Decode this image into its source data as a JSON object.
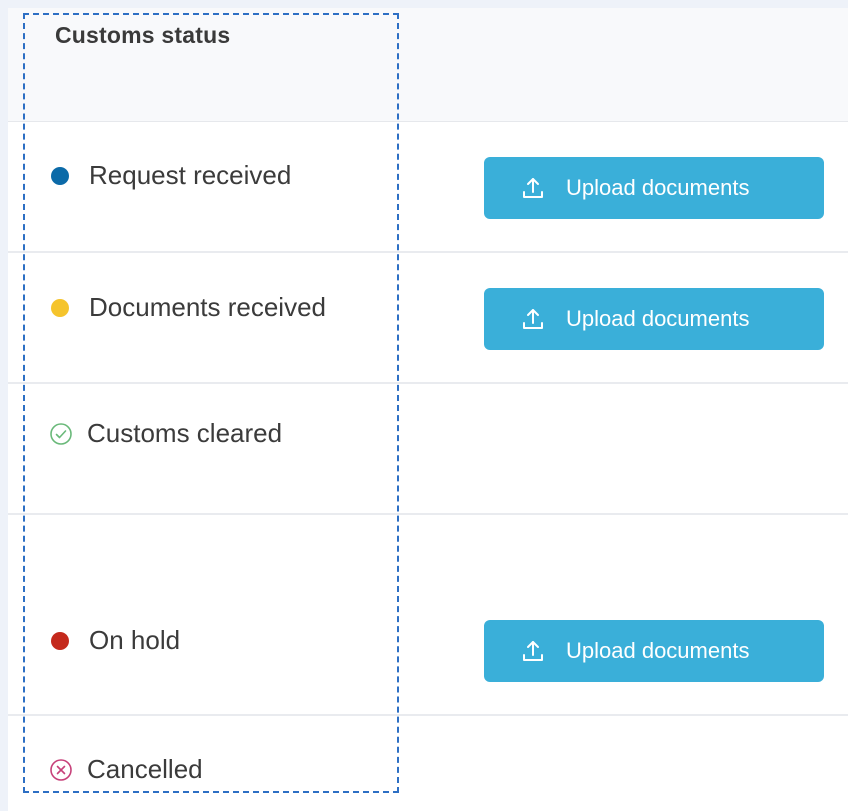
{
  "table": {
    "header": {
      "customs_status": "Customs status"
    },
    "rows": [
      {
        "status": "Request received",
        "indicator": "dot",
        "action": "Upload documents"
      },
      {
        "status": "Documents received",
        "indicator": "dot",
        "action": "Upload documents"
      },
      {
        "status": "Customs cleared",
        "indicator": "check-circle-icon"
      },
      {
        "status": "On hold",
        "indicator": "dot",
        "action": "Upload documents"
      },
      {
        "status": "Cancelled",
        "indicator": "x-circle-icon"
      }
    ]
  },
  "icons": {
    "upload": "upload-icon",
    "cleared": "check-circle-icon",
    "cancelled": "x-circle-icon"
  },
  "colors": {
    "request_received": "#0b6aa8",
    "documents_received": "#f5c42c",
    "customs_cleared": "#6ab97a",
    "on_hold": "#c4291c",
    "cancelled": "#c7417a",
    "button_bg": "#3aafd9",
    "selection_outline": "#2d6fc4",
    "header_bg": "#f8f9fb",
    "page_bg": "#eef2f9"
  }
}
